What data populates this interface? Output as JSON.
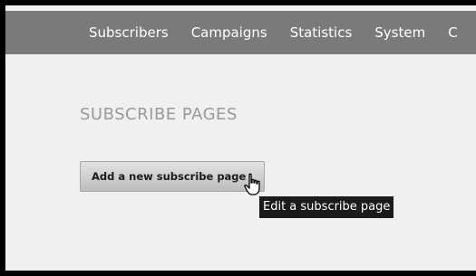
{
  "nav": {
    "items": [
      "Subscribers",
      "Campaigns",
      "Statistics",
      "System",
      "C"
    ]
  },
  "page": {
    "title": "SUBSCRIBE PAGES"
  },
  "actions": {
    "add_label": "Add a new subscribe page"
  },
  "tooltip": {
    "text": "Edit a subscribe page"
  },
  "colors": {
    "nav_bg": "#7a7a7a",
    "page_bg": "#f0f0f0",
    "title": "#9a9a9a",
    "tooltip_bg": "#1b1b1b"
  },
  "icons": {
    "cursor": "hand-pointer-icon"
  }
}
